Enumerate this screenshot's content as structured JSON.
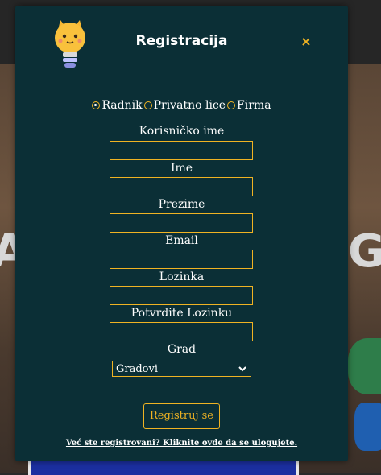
{
  "modal": {
    "title": "Registracija",
    "close_label": "×"
  },
  "account_types": [
    {
      "label": "Radnik",
      "selected": true
    },
    {
      "label": "Privatno lice",
      "selected": false
    },
    {
      "label": "Firma",
      "selected": false
    }
  ],
  "form": {
    "username_label": "Korisničko ime",
    "username_value": "",
    "first_name_label": "Ime",
    "first_name_value": "",
    "last_name_label": "Prezime",
    "last_name_value": "",
    "email_label": "Email",
    "email_value": "",
    "password_label": "Lozinka",
    "password_value": "",
    "confirm_password_label": "Potvrdite Lozinku",
    "confirm_password_value": "",
    "city_label": "Grad",
    "city_selected": "Gradovi"
  },
  "submit_label": "Registruj se",
  "login_link": "Već ste registrovani? Kliknite ovde da se ulogujete.",
  "background": {
    "left_letter": "A",
    "right_letter": "G"
  },
  "colors": {
    "modal_bg": "#0b2f36",
    "accent": "#f0b323",
    "text": "#ffffff"
  }
}
